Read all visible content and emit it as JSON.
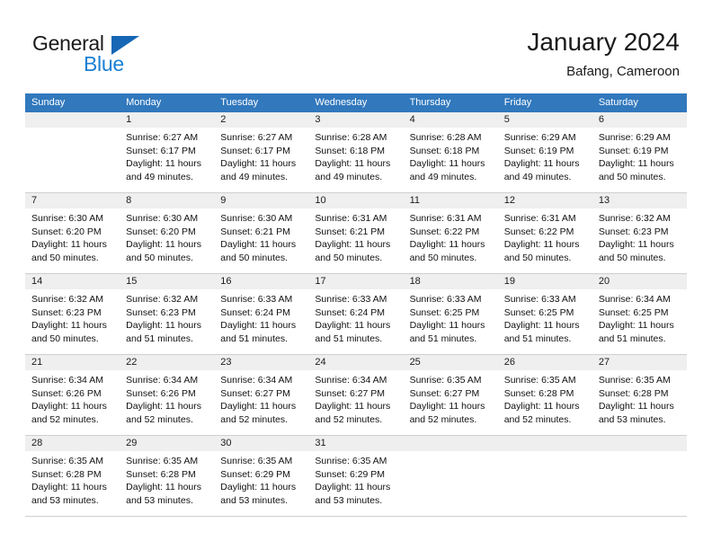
{
  "brand": {
    "name_part1": "General",
    "name_part2": "Blue",
    "triangle_icon": "blue-triangle-icon",
    "accent_color": "#1a7fd4"
  },
  "header": {
    "title": "January 2024",
    "subtitle": "Bafang, Cameroon"
  },
  "theme": {
    "header_row_bg": "#3178bd",
    "day_number_bg": "#efefef",
    "grid_line": "#cfcfcf"
  },
  "weekdays": [
    "Sunday",
    "Monday",
    "Tuesday",
    "Wednesday",
    "Thursday",
    "Friday",
    "Saturday"
  ],
  "weeks": [
    [
      {
        "day": "",
        "lines": []
      },
      {
        "day": "1",
        "lines": [
          "Sunrise: 6:27 AM",
          "Sunset: 6:17 PM",
          "Daylight: 11 hours",
          "and 49 minutes."
        ]
      },
      {
        "day": "2",
        "lines": [
          "Sunrise: 6:27 AM",
          "Sunset: 6:17 PM",
          "Daylight: 11 hours",
          "and 49 minutes."
        ]
      },
      {
        "day": "3",
        "lines": [
          "Sunrise: 6:28 AM",
          "Sunset: 6:18 PM",
          "Daylight: 11 hours",
          "and 49 minutes."
        ]
      },
      {
        "day": "4",
        "lines": [
          "Sunrise: 6:28 AM",
          "Sunset: 6:18 PM",
          "Daylight: 11 hours",
          "and 49 minutes."
        ]
      },
      {
        "day": "5",
        "lines": [
          "Sunrise: 6:29 AM",
          "Sunset: 6:19 PM",
          "Daylight: 11 hours",
          "and 49 minutes."
        ]
      },
      {
        "day": "6",
        "lines": [
          "Sunrise: 6:29 AM",
          "Sunset: 6:19 PM",
          "Daylight: 11 hours",
          "and 50 minutes."
        ]
      }
    ],
    [
      {
        "day": "7",
        "lines": [
          "Sunrise: 6:30 AM",
          "Sunset: 6:20 PM",
          "Daylight: 11 hours",
          "and 50 minutes."
        ]
      },
      {
        "day": "8",
        "lines": [
          "Sunrise: 6:30 AM",
          "Sunset: 6:20 PM",
          "Daylight: 11 hours",
          "and 50 minutes."
        ]
      },
      {
        "day": "9",
        "lines": [
          "Sunrise: 6:30 AM",
          "Sunset: 6:21 PM",
          "Daylight: 11 hours",
          "and 50 minutes."
        ]
      },
      {
        "day": "10",
        "lines": [
          "Sunrise: 6:31 AM",
          "Sunset: 6:21 PM",
          "Daylight: 11 hours",
          "and 50 minutes."
        ]
      },
      {
        "day": "11",
        "lines": [
          "Sunrise: 6:31 AM",
          "Sunset: 6:22 PM",
          "Daylight: 11 hours",
          "and 50 minutes."
        ]
      },
      {
        "day": "12",
        "lines": [
          "Sunrise: 6:31 AM",
          "Sunset: 6:22 PM",
          "Daylight: 11 hours",
          "and 50 minutes."
        ]
      },
      {
        "day": "13",
        "lines": [
          "Sunrise: 6:32 AM",
          "Sunset: 6:23 PM",
          "Daylight: 11 hours",
          "and 50 minutes."
        ]
      }
    ],
    [
      {
        "day": "14",
        "lines": [
          "Sunrise: 6:32 AM",
          "Sunset: 6:23 PM",
          "Daylight: 11 hours",
          "and 50 minutes."
        ]
      },
      {
        "day": "15",
        "lines": [
          "Sunrise: 6:32 AM",
          "Sunset: 6:23 PM",
          "Daylight: 11 hours",
          "and 51 minutes."
        ]
      },
      {
        "day": "16",
        "lines": [
          "Sunrise: 6:33 AM",
          "Sunset: 6:24 PM",
          "Daylight: 11 hours",
          "and 51 minutes."
        ]
      },
      {
        "day": "17",
        "lines": [
          "Sunrise: 6:33 AM",
          "Sunset: 6:24 PM",
          "Daylight: 11 hours",
          "and 51 minutes."
        ]
      },
      {
        "day": "18",
        "lines": [
          "Sunrise: 6:33 AM",
          "Sunset: 6:25 PM",
          "Daylight: 11 hours",
          "and 51 minutes."
        ]
      },
      {
        "day": "19",
        "lines": [
          "Sunrise: 6:33 AM",
          "Sunset: 6:25 PM",
          "Daylight: 11 hours",
          "and 51 minutes."
        ]
      },
      {
        "day": "20",
        "lines": [
          "Sunrise: 6:34 AM",
          "Sunset: 6:25 PM",
          "Daylight: 11 hours",
          "and 51 minutes."
        ]
      }
    ],
    [
      {
        "day": "21",
        "lines": [
          "Sunrise: 6:34 AM",
          "Sunset: 6:26 PM",
          "Daylight: 11 hours",
          "and 52 minutes."
        ]
      },
      {
        "day": "22",
        "lines": [
          "Sunrise: 6:34 AM",
          "Sunset: 6:26 PM",
          "Daylight: 11 hours",
          "and 52 minutes."
        ]
      },
      {
        "day": "23",
        "lines": [
          "Sunrise: 6:34 AM",
          "Sunset: 6:27 PM",
          "Daylight: 11 hours",
          "and 52 minutes."
        ]
      },
      {
        "day": "24",
        "lines": [
          "Sunrise: 6:34 AM",
          "Sunset: 6:27 PM",
          "Daylight: 11 hours",
          "and 52 minutes."
        ]
      },
      {
        "day": "25",
        "lines": [
          "Sunrise: 6:35 AM",
          "Sunset: 6:27 PM",
          "Daylight: 11 hours",
          "and 52 minutes."
        ]
      },
      {
        "day": "26",
        "lines": [
          "Sunrise: 6:35 AM",
          "Sunset: 6:28 PM",
          "Daylight: 11 hours",
          "and 52 minutes."
        ]
      },
      {
        "day": "27",
        "lines": [
          "Sunrise: 6:35 AM",
          "Sunset: 6:28 PM",
          "Daylight: 11 hours",
          "and 53 minutes."
        ]
      }
    ],
    [
      {
        "day": "28",
        "lines": [
          "Sunrise: 6:35 AM",
          "Sunset: 6:28 PM",
          "Daylight: 11 hours",
          "and 53 minutes."
        ]
      },
      {
        "day": "29",
        "lines": [
          "Sunrise: 6:35 AM",
          "Sunset: 6:28 PM",
          "Daylight: 11 hours",
          "and 53 minutes."
        ]
      },
      {
        "day": "30",
        "lines": [
          "Sunrise: 6:35 AM",
          "Sunset: 6:29 PM",
          "Daylight: 11 hours",
          "and 53 minutes."
        ]
      },
      {
        "day": "31",
        "lines": [
          "Sunrise: 6:35 AM",
          "Sunset: 6:29 PM",
          "Daylight: 11 hours",
          "and 53 minutes."
        ]
      },
      {
        "day": "",
        "lines": []
      },
      {
        "day": "",
        "lines": []
      },
      {
        "day": "",
        "lines": []
      }
    ]
  ]
}
